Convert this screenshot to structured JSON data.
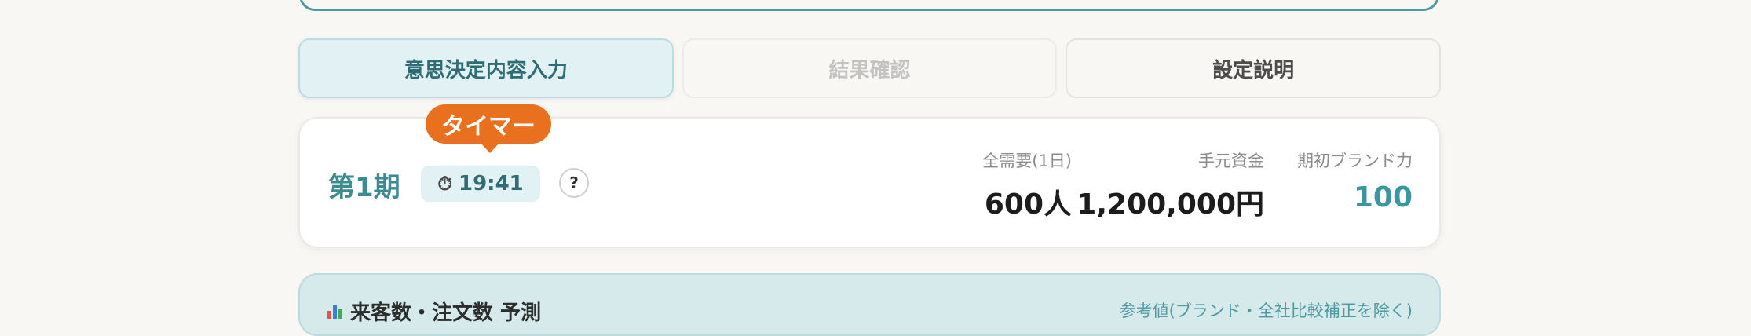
{
  "tabs": [
    {
      "label": "意思決定内容入力",
      "state": "active"
    },
    {
      "label": "結果確認",
      "state": "disabled"
    },
    {
      "label": "設定説明",
      "state": "normal"
    }
  ],
  "status": {
    "period": "第1期",
    "timer_icon": "stopwatch-icon",
    "timer": "19:41",
    "tooltip": "タイマー",
    "help": "?",
    "stats": [
      {
        "label": "全需要(1日)",
        "value": "600人"
      },
      {
        "label": "手元資金",
        "value": "1,200,000円"
      },
      {
        "label": "期初ブランド力",
        "value": "100"
      }
    ]
  },
  "section": {
    "icon": "bar-chart-icon",
    "title": "来客数・注文数 予測",
    "note": "参考値(ブランド・全社比較補正を除く)"
  },
  "colors": {
    "accent": "#3b8b93",
    "tooltip": "#e8701f"
  }
}
